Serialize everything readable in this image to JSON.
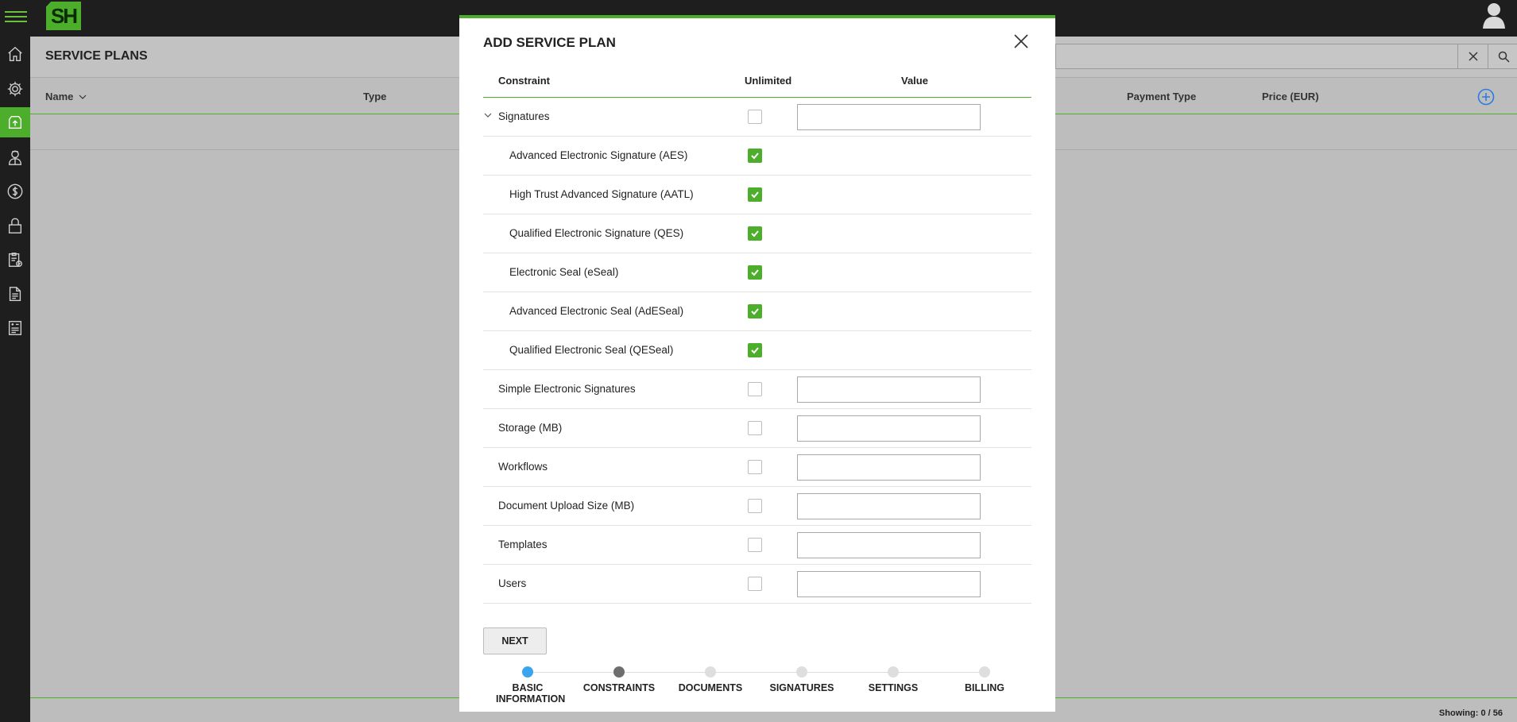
{
  "app": {
    "logo_text": "SH"
  },
  "page": {
    "title": "SERVICE PLANS",
    "columns": [
      "Name",
      "Type",
      "Payment Type",
      "Price (EUR)"
    ],
    "showing": "Showing: 0 / 56"
  },
  "nav": {
    "items": [
      "home-icon",
      "gear-icon",
      "service-plans-icon",
      "users-icon",
      "billing-icon",
      "lock-icon",
      "audit-icon",
      "documents-icon",
      "reports-icon"
    ],
    "active": "service-plans-icon"
  },
  "modal": {
    "title": "ADD SERVICE PLAN",
    "headers": {
      "constraint": "Constraint",
      "unlimited": "Unlimited",
      "value": "Value"
    },
    "rows": [
      {
        "label": "Signatures",
        "checked": false,
        "has_value": true,
        "indent": false,
        "expandable": true
      },
      {
        "label": "Advanced Electronic Signature (AES)",
        "checked": true,
        "has_value": false,
        "indent": true
      },
      {
        "label": "High Trust Advanced Signature (AATL)",
        "checked": true,
        "has_value": false,
        "indent": true
      },
      {
        "label": "Qualified Electronic Signature (QES)",
        "checked": true,
        "has_value": false,
        "indent": true
      },
      {
        "label": "Electronic Seal (eSeal)",
        "checked": true,
        "has_value": false,
        "indent": true
      },
      {
        "label": "Advanced Electronic Seal (AdESeal)",
        "checked": true,
        "has_value": false,
        "indent": true
      },
      {
        "label": "Qualified Electronic Seal (QESeal)",
        "checked": true,
        "has_value": false,
        "indent": true
      },
      {
        "label": "Simple Electronic Signatures",
        "checked": false,
        "has_value": true,
        "indent": false
      },
      {
        "label": "Storage (MB)",
        "checked": false,
        "has_value": true,
        "indent": false
      },
      {
        "label": "Workflows",
        "checked": false,
        "has_value": true,
        "indent": false
      },
      {
        "label": "Document Upload Size (MB)",
        "checked": false,
        "has_value": true,
        "indent": false
      },
      {
        "label": "Templates",
        "checked": false,
        "has_value": true,
        "indent": false
      },
      {
        "label": "Users",
        "checked": false,
        "has_value": true,
        "indent": false
      }
    ],
    "next_label": "NEXT",
    "steps": [
      {
        "label": "BASIC INFORMATION",
        "state": "current"
      },
      {
        "label": "CONSTRAINTS",
        "state": "done"
      },
      {
        "label": "DOCUMENTS",
        "state": "pending"
      },
      {
        "label": "SIGNATURES",
        "state": "pending"
      },
      {
        "label": "SETTINGS",
        "state": "pending"
      },
      {
        "label": "BILLING",
        "state": "pending"
      }
    ]
  },
  "colors": {
    "accent": "#4cae2a",
    "current_step": "#3aa4ee",
    "done_step": "#6e6e6e",
    "add_button": "#2a7de1"
  }
}
